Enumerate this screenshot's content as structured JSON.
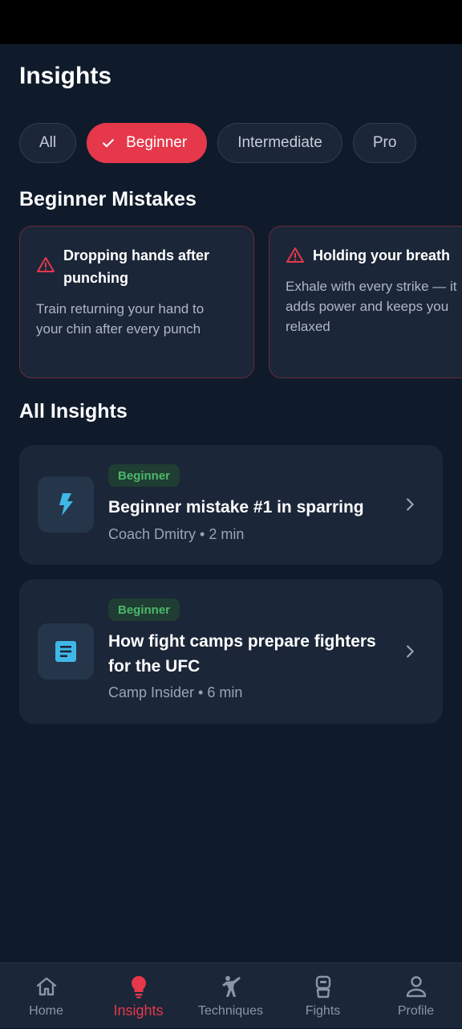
{
  "page": {
    "title": "Insights"
  },
  "filters": {
    "chips": [
      {
        "label": "All"
      },
      {
        "label": "Beginner",
        "selected": true
      },
      {
        "label": "Intermediate"
      },
      {
        "label": "Pro"
      }
    ]
  },
  "beginner_mistakes": {
    "title": "Beginner Mistakes",
    "cards": [
      {
        "title_line1": "Dropping hands after",
        "title_line2": "punching",
        "body_line1": "Train returning your hand to",
        "body_line2": "your chin after every punch"
      },
      {
        "title_line1": "Holding your breath",
        "body_line1": "Exhale with every strike — it",
        "body_line2": "adds power and keeps you",
        "body_line3": "relaxed"
      }
    ]
  },
  "all_insights": {
    "title": "All Insights",
    "items": [
      {
        "badge": "Beginner",
        "title_line1": "Beginner mistake #1 in sparring",
        "meta": "Coach Dmitry • 2 min",
        "icon": "lightning-icon"
      },
      {
        "badge": "Beginner",
        "title_line1": "How fight camps prepare fighters",
        "title_line2": "for the UFC",
        "meta": "Camp Insider • 6 min",
        "icon": "article-icon"
      }
    ]
  },
  "bottom_nav": {
    "items": [
      {
        "label": "Home",
        "icon": "home-icon"
      },
      {
        "label": "Insights",
        "icon": "lightbulb-icon",
        "active": true
      },
      {
        "label": "Techniques",
        "icon": "martial-arts-icon"
      },
      {
        "label": "Fights",
        "icon": "fighter-icon"
      },
      {
        "label": "Profile",
        "icon": "person-icon"
      }
    ]
  },
  "colors": {
    "background": "#0f1b2b",
    "card": "#1b2638",
    "accent": "#e5384a",
    "badge_bg": "#1f3d33",
    "badge_text": "#4cb86b",
    "icon_blue": "#3fb8e8",
    "muted_text": "#9aa5b3"
  }
}
